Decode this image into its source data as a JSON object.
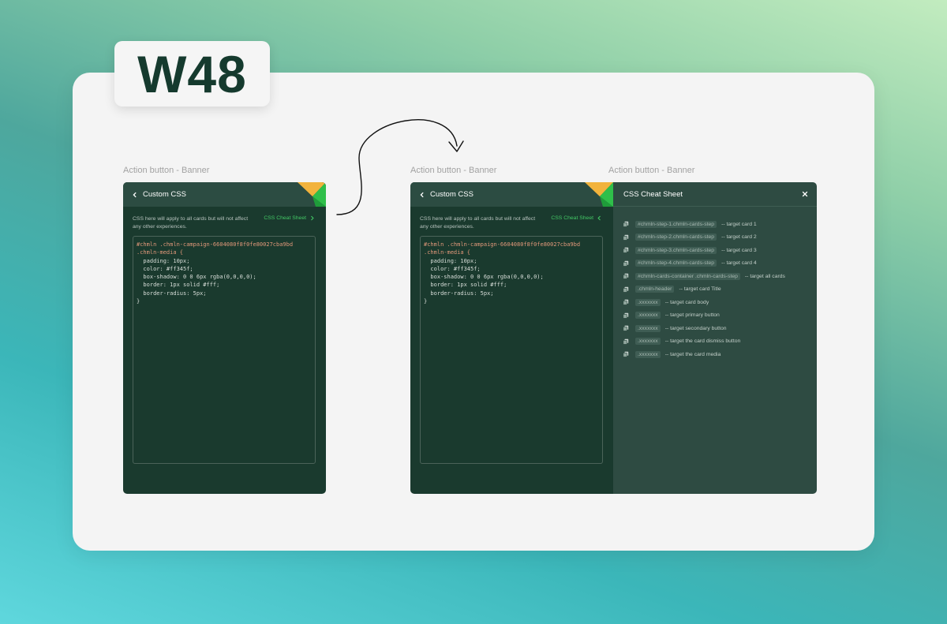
{
  "badge": {
    "text": "W48"
  },
  "frames": [
    {
      "label": "Action button - Banner",
      "title": "Custom CSS",
      "description": "CSS here will apply to all cards but will not affect any other experiences.",
      "cheat_link": "CSS Cheat Sheet",
      "code": [
        "#chmln .chmln-campaign-6604080f8f0fe80027cba9bd",
        ".chmln-media {",
        "  padding: 10px;",
        "  color: #ff345f;",
        "  box-shadow: 0 0 6px rgba(0,0,0,0);",
        "  border: 1px solid #fff;",
        "  border-radius: 5px;",
        "}"
      ]
    },
    {
      "label": "Action button - Banner",
      "title": "Custom CSS",
      "description": "CSS here will apply to all cards but will not affect any other experiences.",
      "cheat_link": "CSS Cheat Sheet",
      "code": [
        "#chmln .chmln-campaign-6604080f8f0fe80027cba9bd",
        ".chmln-media {",
        "  padding: 10px;",
        "  color: #ff345f;",
        "  box-shadow: 0 0 6px rgba(0,0,0,0);",
        "  border: 1px solid #fff;",
        "  border-radius: 5px;",
        "}"
      ]
    }
  ],
  "cheat_sheet": {
    "label": "Action button - Banner",
    "title": "CSS Cheat Sheet",
    "items": [
      {
        "selector": "#chmln-step-1.chmln-cards-step",
        "desc": "-- target card 1"
      },
      {
        "selector": "#chmln-step-2.chmln-cards-step",
        "desc": "-- target card 2"
      },
      {
        "selector": "#chmln-step-3.chmln-cards-step",
        "desc": "-- target card 3"
      },
      {
        "selector": "#chmln-step-4.chmln-cards-step",
        "desc": "-- target card 4"
      },
      {
        "selector": "#chmln-cards-container .chmln-cards-step",
        "desc": "-- target all cards"
      },
      {
        "selector": ".chmln-header",
        "desc": "-- target card Title"
      },
      {
        "selector": ".xxxxxxx",
        "desc": "-- target card body"
      },
      {
        "selector": ".xxxxxxx",
        "desc": "-- target primary button"
      },
      {
        "selector": ".xxxxxxx",
        "desc": "-- target secondary button"
      },
      {
        "selector": ".xxxxxxx",
        "desc": "-- target the card dismiss button"
      },
      {
        "selector": ".xxxxxxx",
        "desc": "-- target the card media"
      }
    ]
  },
  "colors": {
    "panel_bg": "#1a3a2e",
    "panel_header": "#2c4c42",
    "cheat_bg": "#2e4b42",
    "accent_green": "#43c865",
    "logo_yellow": "#f2b33c",
    "logo_green": "#2fbf4a",
    "badge_text": "#153a2e",
    "selector_code": "#e2987a"
  },
  "icons": {
    "back": "chevron-left-icon",
    "forward": "chevron-right-icon",
    "close": "close-icon",
    "copy": "copy-icon",
    "logo": "chameleon-corner-logo",
    "flow": "curved-arrow-icon"
  }
}
